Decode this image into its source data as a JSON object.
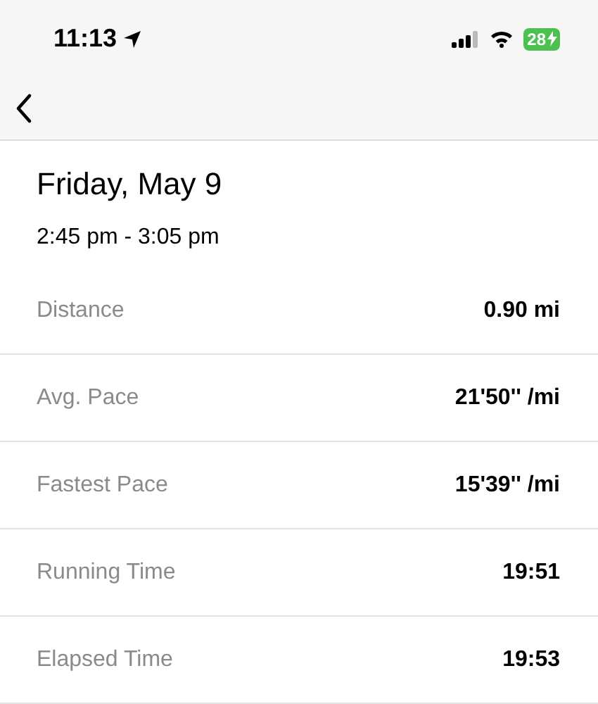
{
  "status_bar": {
    "time": "11:13",
    "battery": "28"
  },
  "title": "Friday, May 9",
  "time_range": "2:45 pm - 3:05 pm",
  "stats": [
    {
      "label": "Distance",
      "value": "0.90 mi"
    },
    {
      "label": "Avg. Pace",
      "value": "21'50'' /mi"
    },
    {
      "label": "Fastest Pace",
      "value": "15'39'' /mi"
    },
    {
      "label": "Running Time",
      "value": "19:51"
    },
    {
      "label": "Elapsed Time",
      "value": "19:53"
    }
  ]
}
